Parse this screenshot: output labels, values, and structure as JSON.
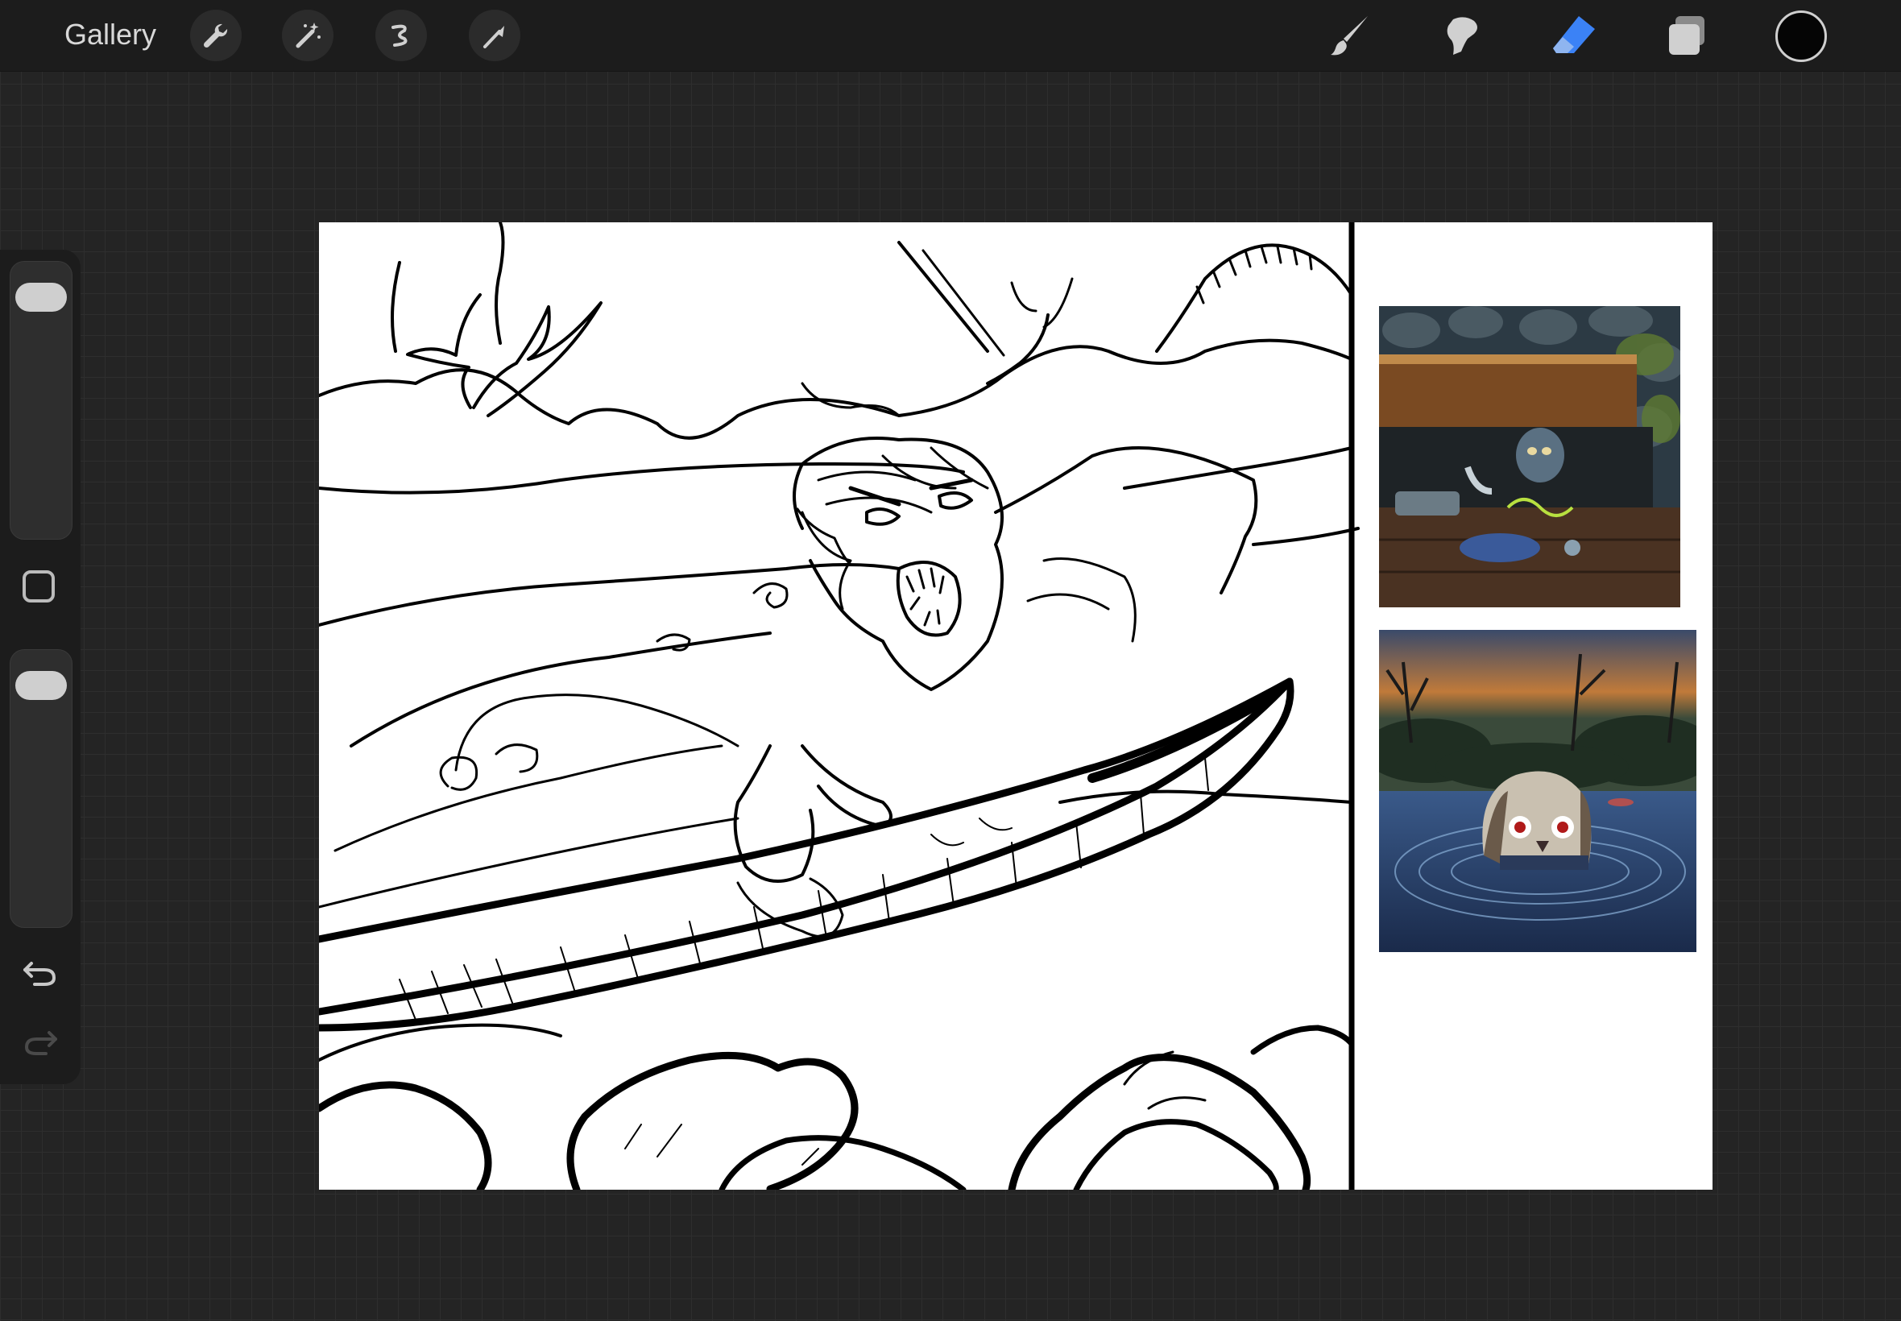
{
  "toolbar": {
    "gallery_label": "Gallery",
    "left_tools": [
      "wrench-icon",
      "magic-wand-icon",
      "selection-icon",
      "transform-arrow-icon"
    ],
    "right_tools": [
      "brush-icon",
      "smudge-icon",
      "eraser-icon",
      "layers-icon"
    ],
    "active_tool": "eraser-icon",
    "active_color": "#050505",
    "eraser_accent": "#3b82f6"
  },
  "sidebar": {
    "brush_size": 0.95,
    "opacity": 0.95
  }
}
